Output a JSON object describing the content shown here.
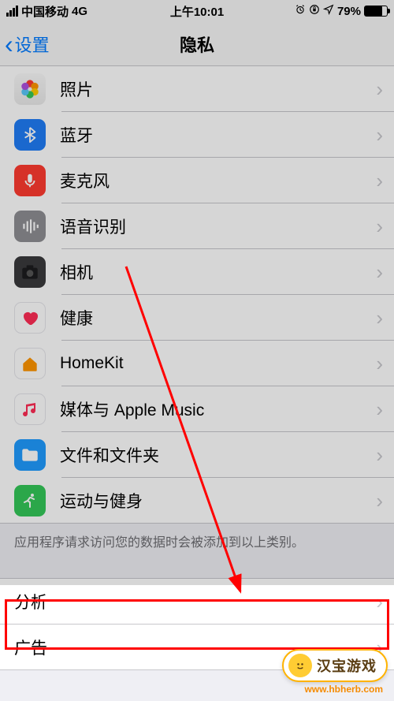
{
  "status": {
    "carrier": "中国移动",
    "network": "4G",
    "time": "上午10:01",
    "alarm_icon": "⏰",
    "orientation_icon": "⤵",
    "location_icon": "➤",
    "battery_pct": "79%"
  },
  "nav": {
    "back_label": "设置",
    "title": "隐私"
  },
  "group1": [
    {
      "icon": "photos-icon",
      "label": "照片"
    },
    {
      "icon": "bluetooth-icon",
      "label": "蓝牙"
    },
    {
      "icon": "microphone-icon",
      "label": "麦克风"
    },
    {
      "icon": "speech-icon",
      "label": "语音识别"
    },
    {
      "icon": "camera-icon",
      "label": "相机"
    },
    {
      "icon": "health-icon",
      "label": "健康"
    },
    {
      "icon": "homekit-icon",
      "label": "HomeKit"
    },
    {
      "icon": "music-icon",
      "label": "媒体与 Apple Music"
    },
    {
      "icon": "files-icon",
      "label": "文件和文件夹"
    },
    {
      "icon": "activity-icon",
      "label": "运动与健身"
    }
  ],
  "group1_footer": "应用程序请求访问您的数据时会被添加到以上类别。",
  "group2": [
    {
      "label": "分析"
    },
    {
      "label": "广告"
    }
  ],
  "watermark": {
    "text": "汉宝游戏",
    "url": "www.hbherb.com"
  },
  "annotation": {
    "highlight_target": "分析",
    "arrow_from": "相机",
    "arrow_to": "分析"
  }
}
